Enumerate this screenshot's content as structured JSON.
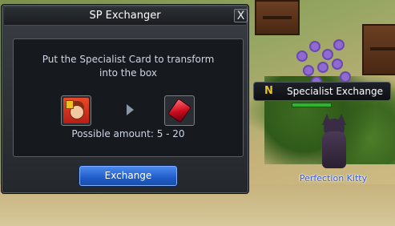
{
  "dialog": {
    "title": "SP Exchanger",
    "close_glyph": "X",
    "instruction": "Put the Specialist Card to transform\ninto the box",
    "amount_text": "Possible amount: 5 - 20",
    "exchange_label": "Exchange",
    "input_item_icon": "specialist-card-icon",
    "result_item_icon": "red-gem-icon",
    "accent_color": "#1f5cc8"
  },
  "npc_tag": {
    "badge": "N",
    "label": "Specialist Exchange",
    "badge_color": "#e8c22c"
  },
  "character": {
    "name": "Perfection Kitty",
    "name_color": "#3a5cc8"
  }
}
